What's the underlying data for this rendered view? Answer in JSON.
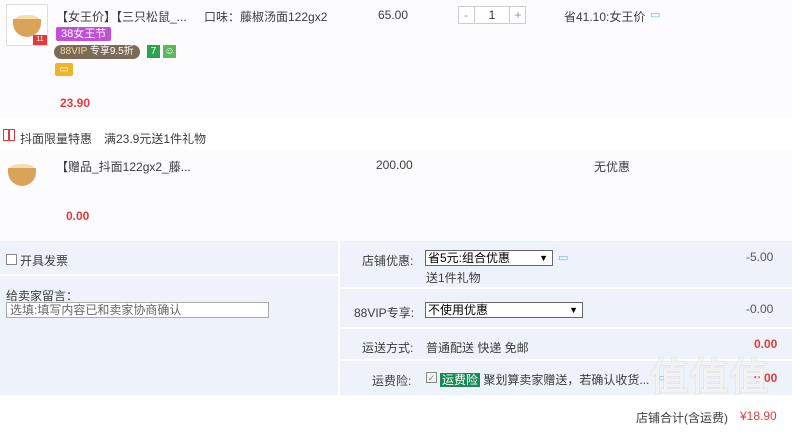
{
  "item1": {
    "title": "【女王价】【三只松鼠_...",
    "flavor": "口味：藤椒汤面122gx2",
    "unit_price": "65.00",
    "quantity": "1",
    "qty_minus": "-",
    "qty_plus": "+",
    "saving": "省41.10:女王价",
    "badge_38": "38女王节",
    "vip_label": "88VIP",
    "vip_discount": "专享9.5折",
    "subtotal": "23.90",
    "thumb_badge": "11"
  },
  "promo": {
    "label": "抖面限量特惠",
    "text": "满23.9元送1件礼物"
  },
  "item2": {
    "title": "【赠品_抖面122gx2_藤...",
    "unit_price": "200.00",
    "discount": "无优惠",
    "subtotal": "0.00"
  },
  "invoice": {
    "label": "开具发票"
  },
  "message": {
    "label": "给卖家留言：",
    "placeholder": "选填:填写内容已和卖家协商确认"
  },
  "shop_discount": {
    "label": "店铺优惠:",
    "selected": "省5元:组合优惠",
    "note": "送1件礼物",
    "amount": "-5.00"
  },
  "vip_discount": {
    "label": "88VIP专享:",
    "selected": "不使用优惠",
    "amount": "-0.00"
  },
  "shipping": {
    "label": "运送方式:",
    "value": "普通配送 快递 免邮",
    "amount": "0.00"
  },
  "insurance": {
    "label": "运费险:",
    "badge": "运费险",
    "text": "聚划算卖家赠送，若确认收货...",
    "amount": "0.00"
  },
  "total": {
    "label": "店铺合计(含运费)",
    "amount": "¥18.90"
  },
  "watermark": "值值值",
  "colors": {
    "accent_red": "#e4393c",
    "bg_blue": "#eef3fb",
    "badge_purple": "#c14fd7"
  }
}
